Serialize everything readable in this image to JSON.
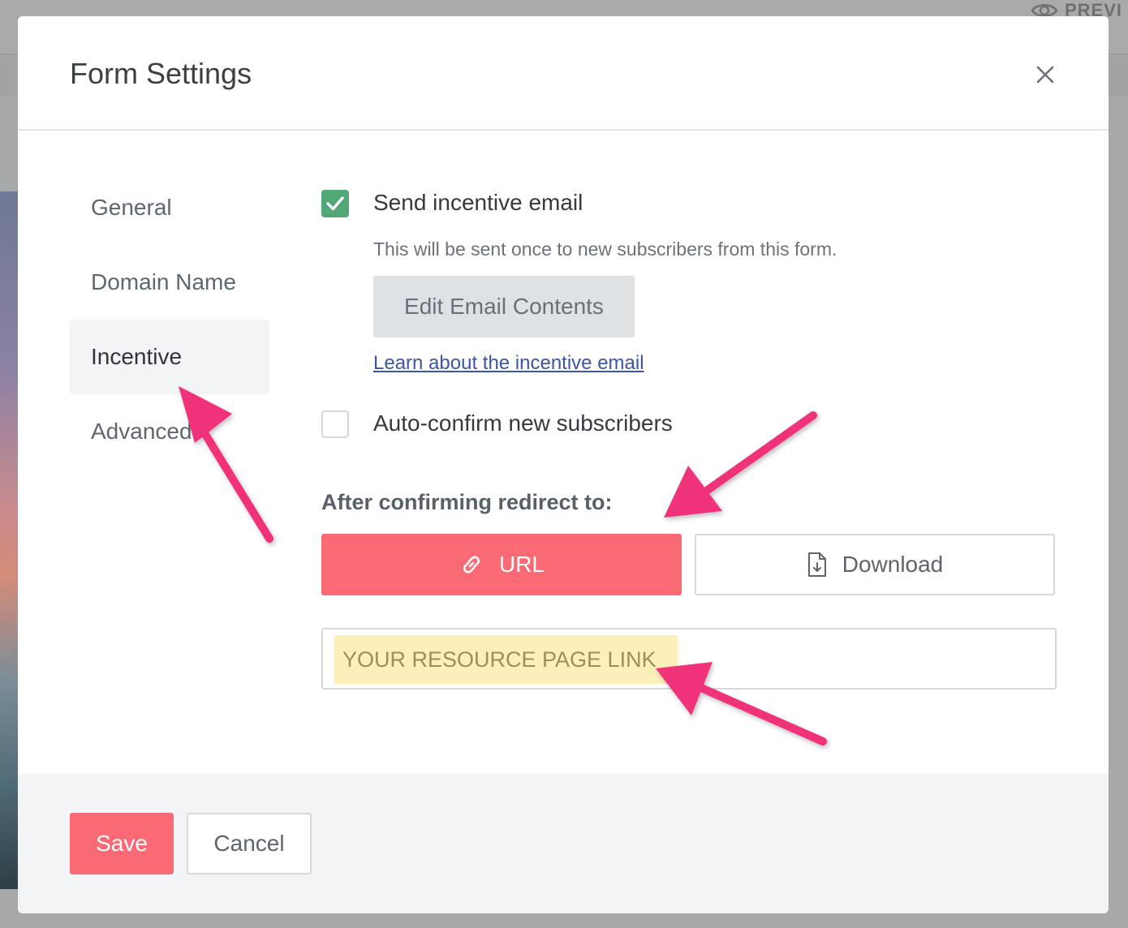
{
  "background": {
    "preview_label": "PREVI"
  },
  "modal": {
    "title": "Form Settings"
  },
  "sidebar": {
    "items": [
      {
        "label": "General",
        "active": false
      },
      {
        "label": "Domain Name",
        "active": false
      },
      {
        "label": "Incentive",
        "active": true
      },
      {
        "label": "Advanced",
        "active": false
      }
    ]
  },
  "incentive": {
    "send_email_label": "Send incentive email",
    "send_email_checked": true,
    "send_email_help": "This will be sent once to new subscribers from this form.",
    "edit_button_label": "Edit Email Contents",
    "learn_link": "Learn about the incentive email",
    "auto_confirm_label": "Auto-confirm new subscribers",
    "auto_confirm_checked": false,
    "redirect_label": "After confirming redirect to:",
    "redirect_options": [
      {
        "label": "URL",
        "icon": "link-icon",
        "selected": true
      },
      {
        "label": "Download",
        "icon": "file-download-icon",
        "selected": false
      }
    ],
    "url_value": "YOUR RESOURCE PAGE LINK"
  },
  "footer": {
    "save_label": "Save",
    "cancel_label": "Cancel"
  },
  "colors": {
    "accent": "#f96a74",
    "checkbox_green": "#52a874",
    "annotation_arrow": "#f0307a",
    "url_highlight": "#fdefba"
  }
}
